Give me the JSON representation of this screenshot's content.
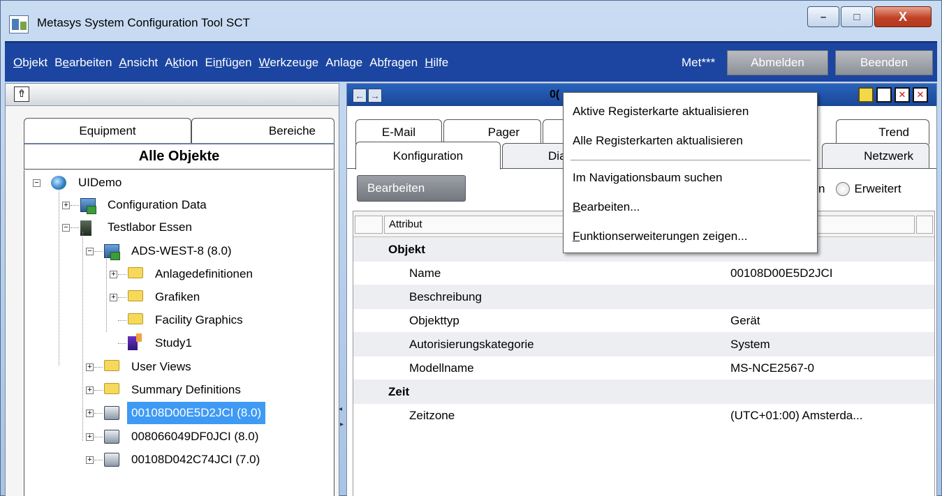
{
  "window": {
    "title": "Metasys System Configuration Tool SCT",
    "min": "–",
    "max": "□",
    "close": "X"
  },
  "menubar": {
    "items": [
      {
        "pre": "",
        "u": "O",
        "post": "bjekt"
      },
      {
        "pre": "B",
        "u": "e",
        "post": "arbeiten"
      },
      {
        "pre": "",
        "u": "A",
        "post": "nsicht"
      },
      {
        "pre": "A",
        "u": "k",
        "post": "tion"
      },
      {
        "pre": "Ei",
        "u": "n",
        "post": "fügen"
      },
      {
        "pre": "",
        "u": "W",
        "post": "erkzeuge"
      },
      {
        "pre": "Anlage",
        "u": "",
        "post": ""
      },
      {
        "pre": "Ab",
        "u": "f",
        "post": "ragen"
      },
      {
        "pre": "",
        "u": "H",
        "post": "ilfe"
      }
    ],
    "user": "Met***",
    "logout": "Abmelden",
    "exit": "Beenden"
  },
  "left": {
    "home_icon": "⇮",
    "tab_equipment": "Equipment",
    "tab_areas": "Bereiche",
    "header": "Alle Objekte",
    "tree": [
      {
        "label": "UIDemo",
        "icon": "globe-icon"
      },
      {
        "label": "Configuration Data",
        "icon": "computer-icon"
      },
      {
        "label": "Testlabor Essen",
        "icon": "building-icon"
      },
      {
        "label": "ADS-WEST-8 (8.0)",
        "icon": "server-icon"
      },
      {
        "label": "Anlagedefinitionen",
        "icon": "folder-icon"
      },
      {
        "label": "Grafiken",
        "icon": "folder-icon"
      },
      {
        "label": "Facility Graphics",
        "icon": "folder-icon"
      },
      {
        "label": "Study1",
        "icon": "study-icon"
      },
      {
        "label": "User Views",
        "icon": "folder-icon"
      },
      {
        "label": "Summary Definitions",
        "icon": "folder-icon"
      },
      {
        "label": "00108D00E5D2JCI (8.0)",
        "icon": "device-icon",
        "selected": true
      },
      {
        "label": "008066049DF0JCI (8.0)",
        "icon": "device-icon"
      },
      {
        "label": "00108D042C74JCI (7.0)",
        "icon": "device-icon"
      }
    ]
  },
  "right": {
    "back": "←",
    "forward": "→",
    "title": "0(",
    "tabs_row1": {
      "email": "E-Mail",
      "pager": "Pager",
      "trend": "Trend"
    },
    "tabs_row2": {
      "konfiguration": "Konfiguration",
      "diag": "Diag",
      "netzwerk": "Netzwerk"
    },
    "edit_button": "Bearbeiten",
    "radio_partial": "n",
    "radio_extended": "Erweitert",
    "grid": {
      "col_attribute": "Attribut",
      "rows": [
        {
          "attr": "Objekt",
          "value": "",
          "section": true
        },
        {
          "attr": "Name",
          "value": "00108D00E5D2JCI"
        },
        {
          "attr": "Beschreibung",
          "value": ""
        },
        {
          "attr": "Objekttyp",
          "value": "Gerät"
        },
        {
          "attr": "Autorisierungskategorie",
          "value": "System"
        },
        {
          "attr": "Modellname",
          "value": "MS-NCE2567-0"
        },
        {
          "attr": "Zeit",
          "value": "",
          "section": true
        },
        {
          "attr": "Zeitzone",
          "value": "(UTC+01:00) Amsterda..."
        }
      ]
    }
  },
  "context_menu": {
    "item1": "Aktive Registerkarte aktualisieren",
    "item2": "Alle Registerkarten aktualisieren",
    "item3": "Im Navigationsbaum suchen",
    "item4_u": "B",
    "item4_rest": "earbeiten...",
    "item5_u": "F",
    "item5_rest": "unktionserweiterungen zeigen..."
  }
}
